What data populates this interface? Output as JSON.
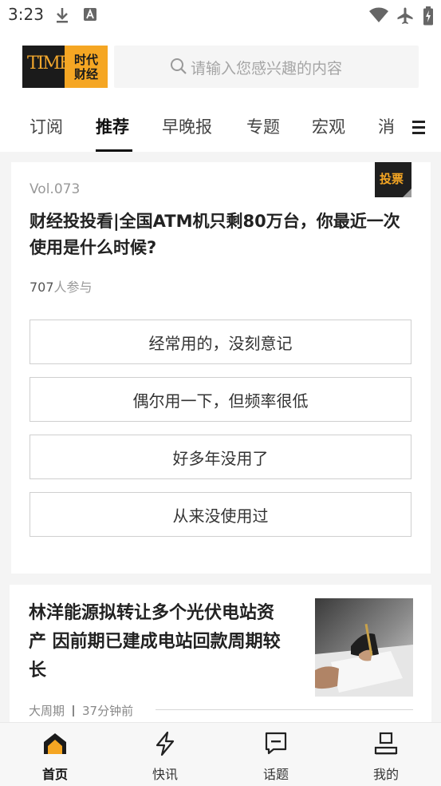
{
  "status_bar": {
    "time": "3:23"
  },
  "header": {
    "logo": {
      "brand_en": "TIME",
      "brand_cn_line1": "时代",
      "brand_cn_line2": "财经"
    },
    "search": {
      "placeholder": "请输入您感兴趣的内容"
    }
  },
  "tabs": [
    {
      "label": "订阅",
      "active": false
    },
    {
      "label": "推荐",
      "active": true
    },
    {
      "label": "早晚报",
      "active": false
    },
    {
      "label": "专题",
      "active": false
    },
    {
      "label": "宏观",
      "active": false
    },
    {
      "label": "消",
      "active": false
    }
  ],
  "poll": {
    "volume": "Vol.073",
    "badge": "投票",
    "title": "财经投投看|全国ATM机只剩80万台，你最近一次使用是什么时候?",
    "participants_count": "707",
    "participants_suffix": "人参与",
    "options": [
      "经常用的，没刻意记",
      "偶尔用一下，但频率很低",
      "好多年没用了",
      "从来没使用过"
    ]
  },
  "article": {
    "title": "林洋能源拟转让多个光伏电站资产 因前期已建成电站回款周期较长",
    "source": "大周期",
    "time_ago": "37分钟前"
  },
  "bottom_nav": [
    {
      "label": "首页",
      "icon": "home-icon",
      "active": true
    },
    {
      "label": "快讯",
      "icon": "lightning-icon",
      "active": false
    },
    {
      "label": "话题",
      "icon": "topic-icon",
      "active": false
    },
    {
      "label": "我的",
      "icon": "profile-icon",
      "active": false
    }
  ],
  "colors": {
    "accent": "#f5a623",
    "dark": "#1b1b1b"
  }
}
